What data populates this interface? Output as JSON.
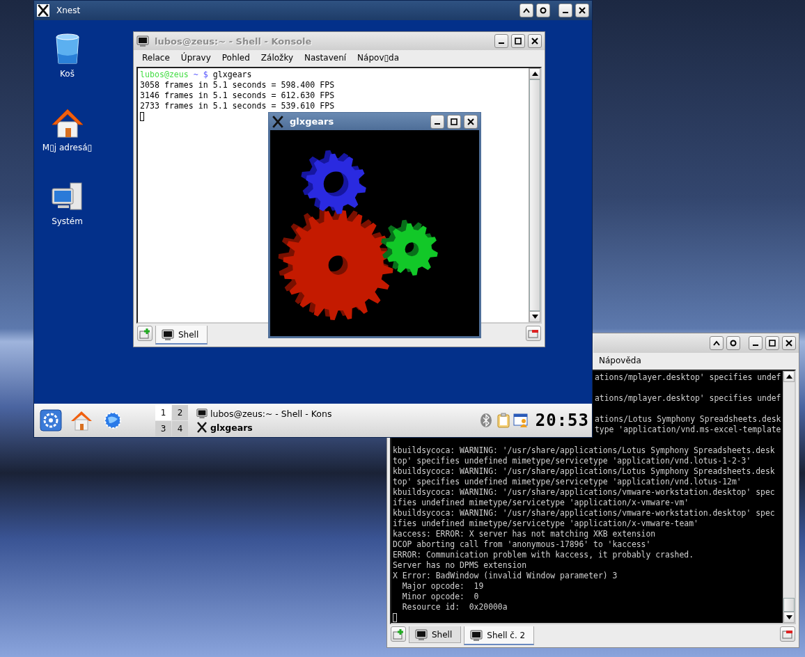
{
  "back_konsole": {
    "active": false,
    "menu": [
      "Nápověda"
    ],
    "lines": [
      {
        "kind": "clipped",
        "text": "ations/mplayer.desktop' specifies undef"
      },
      {
        "kind": "blank"
      },
      {
        "kind": "clipped",
        "text": "ations/mplayer.desktop' specifies undef"
      },
      {
        "kind": "blank"
      },
      {
        "kind": "clipped",
        "text": "ations/Lotus Symphony Spreadsheets.desk"
      },
      {
        "kind": "clipped",
        "text": "type 'application/vnd.ms-excel-template"
      },
      {
        "kind": "blank"
      },
      {
        "kind": "full",
        "text": "kbuildsycoca: WARNING: '/usr/share/applications/Lotus Symphony Spreadsheets.desk"
      },
      {
        "kind": "full",
        "text": "top' specifies undefined mimetype/servicetype 'application/vnd.lotus-1-2-3'"
      },
      {
        "kind": "full",
        "text": "kbuildsycoca: WARNING: '/usr/share/applications/Lotus Symphony Spreadsheets.desk"
      },
      {
        "kind": "full",
        "text": "top' specifies undefined mimetype/servicetype 'application/vnd.lotus-12m'"
      },
      {
        "kind": "full",
        "text": "kbuildsycoca: WARNING: '/usr/share/applications/vmware-workstation.desktop' spec"
      },
      {
        "kind": "full",
        "text": "ifies undefined mimetype/servicetype 'application/x-vmware-vm'"
      },
      {
        "kind": "full",
        "text": "kbuildsycoca: WARNING: '/usr/share/applications/vmware-workstation.desktop' spec"
      },
      {
        "kind": "full",
        "text": "ifies undefined mimetype/servicetype 'application/x-vmware-team'"
      },
      {
        "kind": "full",
        "text": "kaccess: ERROR: X server has not matching XKB extension"
      },
      {
        "kind": "full",
        "text": "DCOP aborting call from 'anonymous-17896' to 'kaccess'"
      },
      {
        "kind": "full",
        "text": "ERROR: Communication problem with kaccess, it probably crashed."
      },
      {
        "kind": "full",
        "text": "Server has no DPMS extension"
      },
      {
        "kind": "full",
        "text": "X Error: BadWindow (invalid Window parameter) 3"
      },
      {
        "kind": "full",
        "text": "  Major opcode:  19"
      },
      {
        "kind": "full",
        "text": "  Minor opcode:  0"
      },
      {
        "kind": "full",
        "text": "  Resource id:  0x20000a"
      }
    ],
    "tabs": [
      {
        "label": "Shell",
        "selected": false
      },
      {
        "label": "Shell č. 2",
        "selected": true
      }
    ]
  },
  "xnest": {
    "title": "Xnest",
    "active": true,
    "desktop_icons": [
      {
        "kind": "trash",
        "label": "Koš"
      },
      {
        "kind": "home",
        "label": "M▯j adresá▯"
      },
      {
        "kind": "computer",
        "label": "Systém"
      }
    ],
    "konsole": {
      "title": "lubos@zeus:~ - Shell - Konsole",
      "active": false,
      "menu": [
        "Relace",
        "Úpravy",
        "Pohled",
        "Záložky",
        "Nastavení",
        "Nápov▯da"
      ],
      "prompt": {
        "user_host": "lubos@zeus",
        "path": "~ $",
        "command": "glxgears"
      },
      "lines": [
        "3058 frames in 5.1 seconds = 598.400 FPS",
        "3146 frames in 5.1 seconds = 612.630 FPS",
        "2733 frames in 5.1 seconds = 539.610 FPS"
      ],
      "tabs": [
        {
          "label": "Shell",
          "selected": true
        }
      ]
    },
    "glxgears": {
      "title": "glxgears",
      "active": true
    },
    "panel": {
      "pager": [
        {
          "label": "1",
          "selected": true
        },
        {
          "label": "2",
          "selected": false
        },
        {
          "label": "3",
          "selected": false
        },
        {
          "label": "4",
          "selected": false
        }
      ],
      "tasks": [
        {
          "kind": "terminal",
          "label": "lubos@zeus:~ - Shell - Kons",
          "active": false
        },
        {
          "kind": "x",
          "label": "glxgears",
          "active": true
        }
      ],
      "clock": "20:53"
    }
  }
}
